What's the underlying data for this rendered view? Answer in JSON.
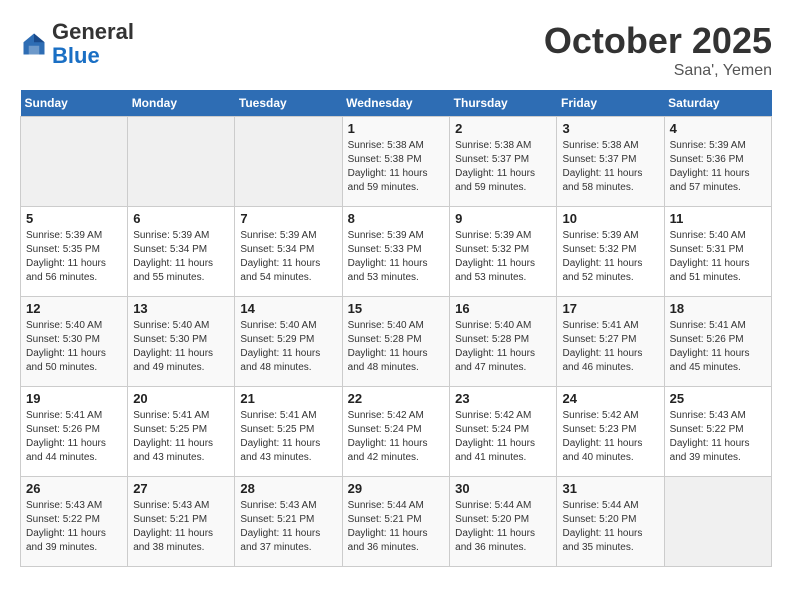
{
  "header": {
    "logo_general": "General",
    "logo_blue": "Blue",
    "month_title": "October 2025",
    "location": "Sana', Yemen"
  },
  "days_of_week": [
    "Sunday",
    "Monday",
    "Tuesday",
    "Wednesday",
    "Thursday",
    "Friday",
    "Saturday"
  ],
  "weeks": [
    [
      {
        "day": "",
        "sunrise": "",
        "sunset": "",
        "daylight": ""
      },
      {
        "day": "",
        "sunrise": "",
        "sunset": "",
        "daylight": ""
      },
      {
        "day": "",
        "sunrise": "",
        "sunset": "",
        "daylight": ""
      },
      {
        "day": "1",
        "sunrise": "Sunrise: 5:38 AM",
        "sunset": "Sunset: 5:38 PM",
        "daylight": "Daylight: 11 hours and 59 minutes."
      },
      {
        "day": "2",
        "sunrise": "Sunrise: 5:38 AM",
        "sunset": "Sunset: 5:37 PM",
        "daylight": "Daylight: 11 hours and 59 minutes."
      },
      {
        "day": "3",
        "sunrise": "Sunrise: 5:38 AM",
        "sunset": "Sunset: 5:37 PM",
        "daylight": "Daylight: 11 hours and 58 minutes."
      },
      {
        "day": "4",
        "sunrise": "Sunrise: 5:39 AM",
        "sunset": "Sunset: 5:36 PM",
        "daylight": "Daylight: 11 hours and 57 minutes."
      }
    ],
    [
      {
        "day": "5",
        "sunrise": "Sunrise: 5:39 AM",
        "sunset": "Sunset: 5:35 PM",
        "daylight": "Daylight: 11 hours and 56 minutes."
      },
      {
        "day": "6",
        "sunrise": "Sunrise: 5:39 AM",
        "sunset": "Sunset: 5:34 PM",
        "daylight": "Daylight: 11 hours and 55 minutes."
      },
      {
        "day": "7",
        "sunrise": "Sunrise: 5:39 AM",
        "sunset": "Sunset: 5:34 PM",
        "daylight": "Daylight: 11 hours and 54 minutes."
      },
      {
        "day": "8",
        "sunrise": "Sunrise: 5:39 AM",
        "sunset": "Sunset: 5:33 PM",
        "daylight": "Daylight: 11 hours and 53 minutes."
      },
      {
        "day": "9",
        "sunrise": "Sunrise: 5:39 AM",
        "sunset": "Sunset: 5:32 PM",
        "daylight": "Daylight: 11 hours and 53 minutes."
      },
      {
        "day": "10",
        "sunrise": "Sunrise: 5:39 AM",
        "sunset": "Sunset: 5:32 PM",
        "daylight": "Daylight: 11 hours and 52 minutes."
      },
      {
        "day": "11",
        "sunrise": "Sunrise: 5:40 AM",
        "sunset": "Sunset: 5:31 PM",
        "daylight": "Daylight: 11 hours and 51 minutes."
      }
    ],
    [
      {
        "day": "12",
        "sunrise": "Sunrise: 5:40 AM",
        "sunset": "Sunset: 5:30 PM",
        "daylight": "Daylight: 11 hours and 50 minutes."
      },
      {
        "day": "13",
        "sunrise": "Sunrise: 5:40 AM",
        "sunset": "Sunset: 5:30 PM",
        "daylight": "Daylight: 11 hours and 49 minutes."
      },
      {
        "day": "14",
        "sunrise": "Sunrise: 5:40 AM",
        "sunset": "Sunset: 5:29 PM",
        "daylight": "Daylight: 11 hours and 48 minutes."
      },
      {
        "day": "15",
        "sunrise": "Sunrise: 5:40 AM",
        "sunset": "Sunset: 5:28 PM",
        "daylight": "Daylight: 11 hours and 48 minutes."
      },
      {
        "day": "16",
        "sunrise": "Sunrise: 5:40 AM",
        "sunset": "Sunset: 5:28 PM",
        "daylight": "Daylight: 11 hours and 47 minutes."
      },
      {
        "day": "17",
        "sunrise": "Sunrise: 5:41 AM",
        "sunset": "Sunset: 5:27 PM",
        "daylight": "Daylight: 11 hours and 46 minutes."
      },
      {
        "day": "18",
        "sunrise": "Sunrise: 5:41 AM",
        "sunset": "Sunset: 5:26 PM",
        "daylight": "Daylight: 11 hours and 45 minutes."
      }
    ],
    [
      {
        "day": "19",
        "sunrise": "Sunrise: 5:41 AM",
        "sunset": "Sunset: 5:26 PM",
        "daylight": "Daylight: 11 hours and 44 minutes."
      },
      {
        "day": "20",
        "sunrise": "Sunrise: 5:41 AM",
        "sunset": "Sunset: 5:25 PM",
        "daylight": "Daylight: 11 hours and 43 minutes."
      },
      {
        "day": "21",
        "sunrise": "Sunrise: 5:41 AM",
        "sunset": "Sunset: 5:25 PM",
        "daylight": "Daylight: 11 hours and 43 minutes."
      },
      {
        "day": "22",
        "sunrise": "Sunrise: 5:42 AM",
        "sunset": "Sunset: 5:24 PM",
        "daylight": "Daylight: 11 hours and 42 minutes."
      },
      {
        "day": "23",
        "sunrise": "Sunrise: 5:42 AM",
        "sunset": "Sunset: 5:24 PM",
        "daylight": "Daylight: 11 hours and 41 minutes."
      },
      {
        "day": "24",
        "sunrise": "Sunrise: 5:42 AM",
        "sunset": "Sunset: 5:23 PM",
        "daylight": "Daylight: 11 hours and 40 minutes."
      },
      {
        "day": "25",
        "sunrise": "Sunrise: 5:43 AM",
        "sunset": "Sunset: 5:22 PM",
        "daylight": "Daylight: 11 hours and 39 minutes."
      }
    ],
    [
      {
        "day": "26",
        "sunrise": "Sunrise: 5:43 AM",
        "sunset": "Sunset: 5:22 PM",
        "daylight": "Daylight: 11 hours and 39 minutes."
      },
      {
        "day": "27",
        "sunrise": "Sunrise: 5:43 AM",
        "sunset": "Sunset: 5:21 PM",
        "daylight": "Daylight: 11 hours and 38 minutes."
      },
      {
        "day": "28",
        "sunrise": "Sunrise: 5:43 AM",
        "sunset": "Sunset: 5:21 PM",
        "daylight": "Daylight: 11 hours and 37 minutes."
      },
      {
        "day": "29",
        "sunrise": "Sunrise: 5:44 AM",
        "sunset": "Sunset: 5:21 PM",
        "daylight": "Daylight: 11 hours and 36 minutes."
      },
      {
        "day": "30",
        "sunrise": "Sunrise: 5:44 AM",
        "sunset": "Sunset: 5:20 PM",
        "daylight": "Daylight: 11 hours and 36 minutes."
      },
      {
        "day": "31",
        "sunrise": "Sunrise: 5:44 AM",
        "sunset": "Sunset: 5:20 PM",
        "daylight": "Daylight: 11 hours and 35 minutes."
      },
      {
        "day": "",
        "sunrise": "",
        "sunset": "",
        "daylight": ""
      }
    ]
  ]
}
